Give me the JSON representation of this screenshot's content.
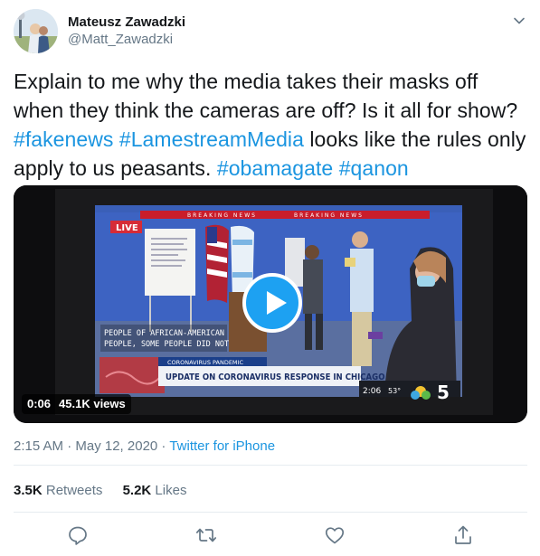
{
  "author": {
    "display_name": "Mateusz Zawadzki",
    "handle": "@Matt_Zawadzki"
  },
  "tweet": {
    "lines": [
      [
        {
          "text": "Explain to me why the media takes their masks off",
          "tag": false
        }
      ],
      [
        {
          "text": "when they think the cameras are off? Is it all for show?",
          "tag": false
        }
      ],
      [
        {
          "text": "#fakenews",
          "tag": true
        },
        {
          "text": " ",
          "tag": false
        },
        {
          "text": "#LamestreamMedia",
          "tag": true
        },
        {
          "text": " looks like the rules only",
          "tag": false
        }
      ],
      [
        {
          "text": "apply to us peasants. ",
          "tag": false
        },
        {
          "text": "#obamagate",
          "tag": true
        },
        {
          "text": " ",
          "tag": false
        },
        {
          "text": "#qanon",
          "tag": true
        }
      ]
    ]
  },
  "video": {
    "elapsed": "0:06",
    "views": "45.1K views",
    "overlay": {
      "live_badge": "LIVE",
      "banner_left": "BREAKING NEWS",
      "banner_right": "BREAKING NEWS",
      "caption_line1": "PEOPLE OF AFRICAN-AMERICAN",
      "caption_line2": "PEOPLE, SOME PEOPLE DID NOT",
      "lower_third_kicker": "CORONAVIRUS PANDEMIC",
      "lower_third_headline": "UPDATE ON CORONAVIRUS RESPONSE IN CHICAGO",
      "clock": "2:06",
      "temperature": "53°",
      "channel": "5"
    }
  },
  "meta": {
    "time_date": "2:15 AM · May 12, 2020 · ",
    "source": "Twitter for iPhone"
  },
  "stats": {
    "retweets_count": "3.5K",
    "retweets_label": "Retweets",
    "likes_count": "5.2K",
    "likes_label": "Likes"
  },
  "icons": {
    "reply": "reply-icon",
    "retweet": "retweet-icon",
    "like": "like-icon",
    "share": "share-icon",
    "more": "chevron-down-icon"
  },
  "colors": {
    "accent": "#1da1f2",
    "link": "#1b95e0",
    "secondary_text": "#657786",
    "divider": "#e6ecf0"
  }
}
